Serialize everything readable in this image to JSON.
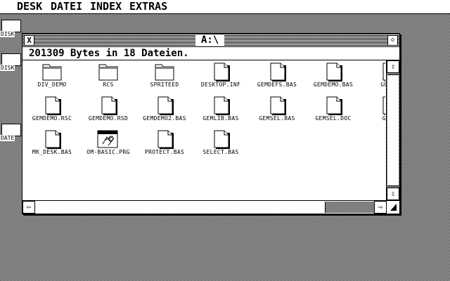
{
  "menubar": {
    "items": [
      "DESK",
      "DATEI",
      "INDEX",
      "EXTRAS"
    ]
  },
  "desktop_icons": [
    {
      "label": "DISK"
    },
    {
      "label": "DISK"
    },
    {
      "label": "DATE"
    }
  ],
  "window": {
    "title": "A:\\",
    "close_glyph": "X",
    "full_glyph": "◇",
    "info": "201309 Bytes in 18 Dateien.",
    "files": [
      {
        "name": "DIV_DEMO",
        "type": "folder-icon"
      },
      {
        "name": "RCS",
        "type": "folder-icon"
      },
      {
        "name": "SPRITEED",
        "type": "folder-icon"
      },
      {
        "name": "DESKTOP.INF",
        "type": "document-icon"
      },
      {
        "name": "GEMDEFS.BAS",
        "type": "document-icon"
      },
      {
        "name": "GEMDEMO.BAS",
        "type": "document-icon"
      },
      {
        "name": "GEMDE",
        "type": "document-icon"
      },
      {
        "name": "GEMDEMO.RSC",
        "type": "document-icon"
      },
      {
        "name": "GEMDEMO.RSD",
        "type": "document-icon"
      },
      {
        "name": "GEMDEMO2.BAS",
        "type": "document-icon"
      },
      {
        "name": "GEMLIB.BAS",
        "type": "document-icon"
      },
      {
        "name": "GEMSEL.BAS",
        "type": "document-icon"
      },
      {
        "name": "GEMSEL.DOC",
        "type": "document-icon"
      },
      {
        "name": "GEMS",
        "type": "document-icon"
      },
      {
        "name": "MK_DESK.BAS",
        "type": "document-icon"
      },
      {
        "name": "OM-BASIC.PRG",
        "type": "application-icon"
      },
      {
        "name": "PROTECT.BAS",
        "type": "document-icon"
      },
      {
        "name": "SELECT.BAS",
        "type": "document-icon"
      }
    ],
    "scroll": {
      "up": "⇧",
      "down": "⇩",
      "left": "⇦",
      "right": "⇨"
    }
  }
}
